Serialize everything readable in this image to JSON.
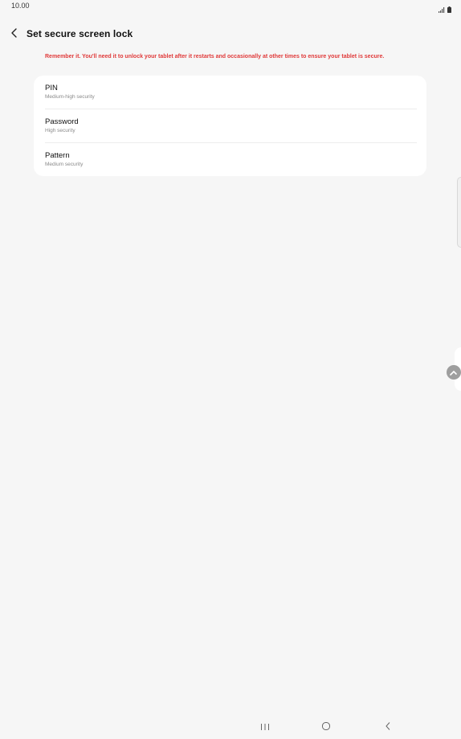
{
  "status_bar": {
    "time": "10.00",
    "signal_icon": "signal-icon",
    "battery_icon": "battery-icon"
  },
  "header": {
    "back_icon": "chevron-left-icon",
    "title": "Set secure screen lock"
  },
  "warning": {
    "text": "Remember it. You'll need it to unlock your tablet after it restarts and occasionally at other times to ensure your tablet is secure.",
    "color": "#e03a3a"
  },
  "options": [
    {
      "title": "PIN",
      "subtitle": "Medium-high security"
    },
    {
      "title": "Password",
      "subtitle": "High security"
    },
    {
      "title": "Pattern",
      "subtitle": "Medium security"
    }
  ],
  "nav_bar": {
    "recents_icon": "recents-icon",
    "home_icon": "home-icon",
    "back_icon": "back-icon"
  },
  "colors": {
    "background": "#f6f6f6",
    "card": "#ffffff",
    "subtitle": "#8a8a8a"
  }
}
